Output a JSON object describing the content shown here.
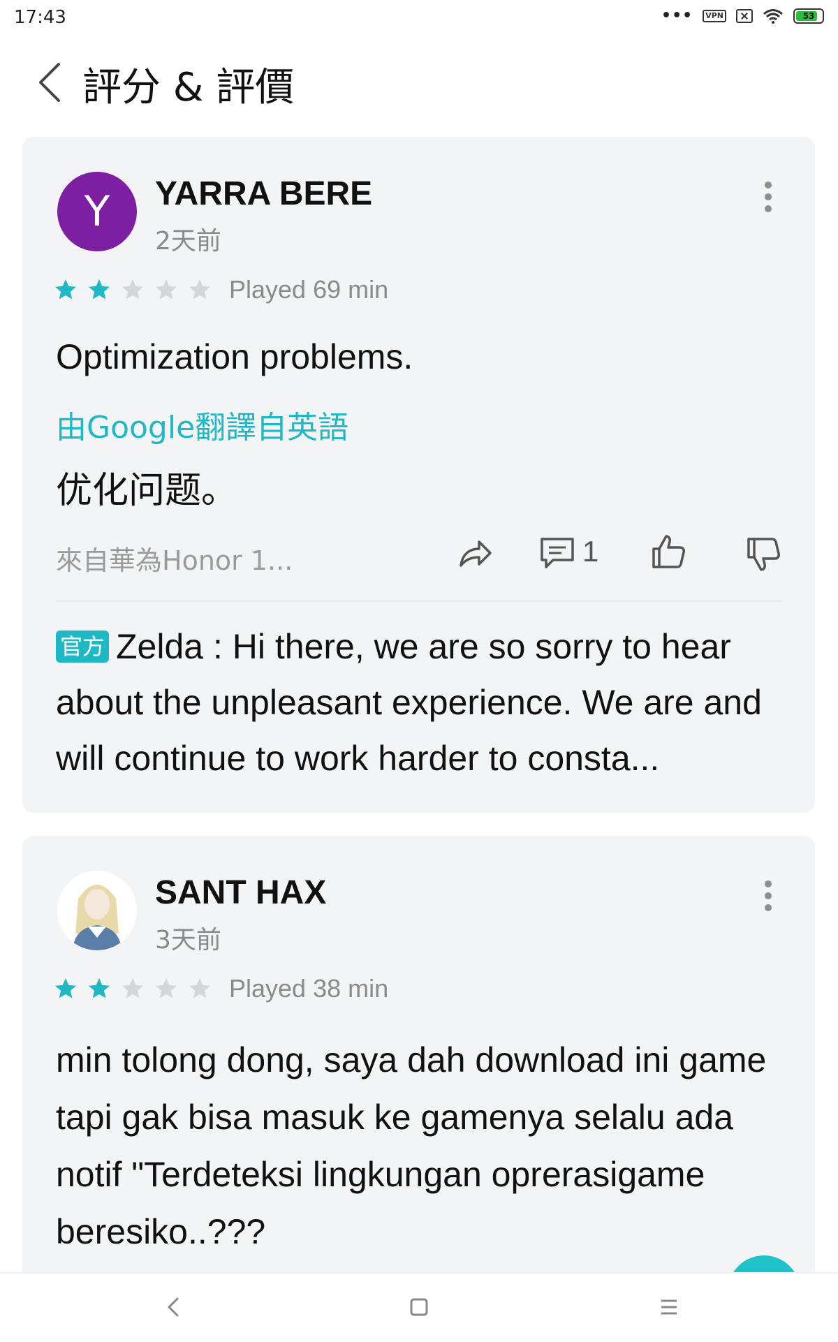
{
  "status_bar": {
    "time": "17:43",
    "dots": "•••",
    "vpn_label": "VPN",
    "battery": "53",
    "icons": [
      "vpn-icon",
      "close-box-icon",
      "wifi-icon",
      "battery-icon"
    ]
  },
  "header": {
    "title": "評分 & 評價",
    "back_icon": "chevron-left-icon"
  },
  "reviews": [
    {
      "avatar_letter": "Y",
      "avatar_color": "#7d1fa3",
      "username": "YARRA BERE",
      "time_ago": "2天前",
      "rating": 2,
      "max_rating": 5,
      "played": "Played 69 min",
      "text": "Optimization problems.",
      "translation_note": "由Google翻譯自英語",
      "translated_text": "优化问题。",
      "device": "來自華為Honor 1...",
      "comment_count": "1",
      "reply": {
        "badge": "官方",
        "text": "Zelda : Hi there, we are so sorry to hear about the unpleasant experience. We are and will continue to work harder to consta..."
      }
    },
    {
      "avatar_image": "anime-character-avatar",
      "username": "SANT HAX",
      "time_ago": "3天前",
      "rating": 2,
      "max_rating": 5,
      "played": "Played 38 min",
      "text": "min tolong dong, saya dah download ini game tapi gak bisa masuk ke gamenya selalu ada notif \"Terdeteksi lingkungan oprerasigame beresiko..???"
    }
  ],
  "colors": {
    "accent": "#1fb8c5",
    "star_filled": "#1fb8c5",
    "star_empty": "#d4d6d9",
    "card_bg": "#f3f4f6"
  },
  "nav": {
    "icons": [
      "back-nav-icon",
      "home-nav-icon",
      "menu-nav-icon"
    ]
  }
}
